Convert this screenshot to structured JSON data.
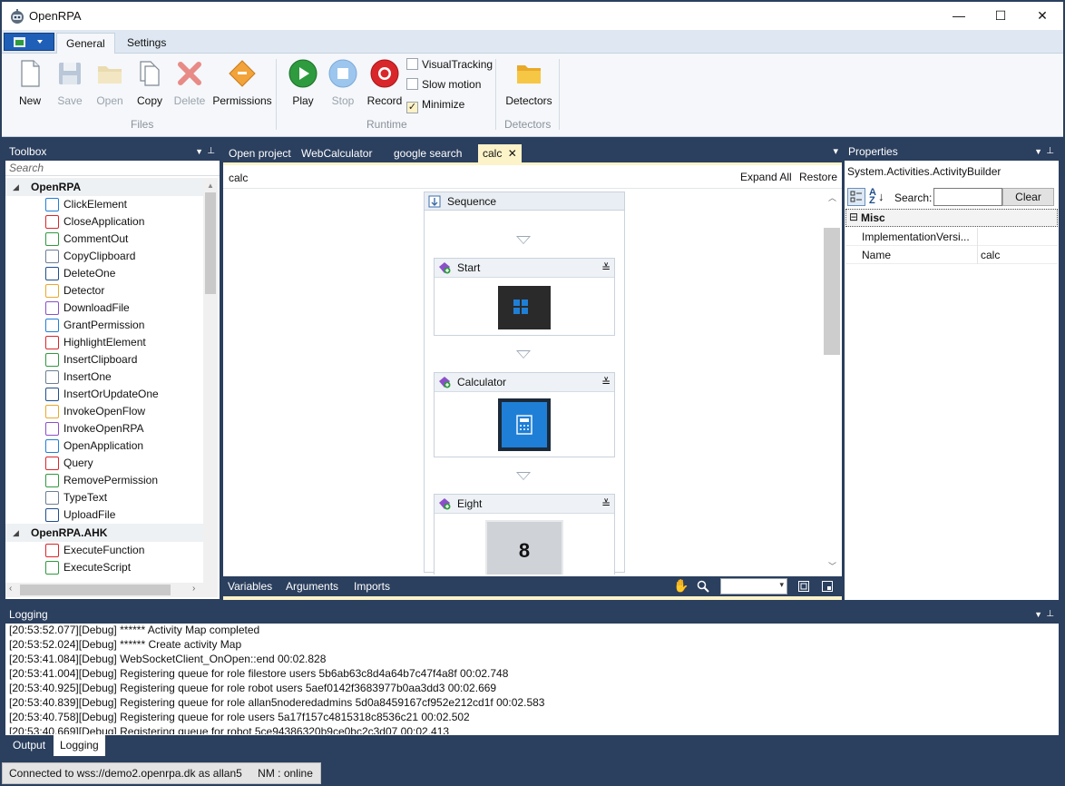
{
  "window": {
    "title": "OpenRPA",
    "controls": [
      "—",
      "☐",
      "✕"
    ]
  },
  "ribbon": {
    "tabs": [
      {
        "label": "General",
        "active": true
      },
      {
        "label": "Settings",
        "active": false
      }
    ],
    "files": {
      "group_label": "Files",
      "buttons": [
        {
          "label": "New",
          "enabled": true
        },
        {
          "label": "Save",
          "enabled": false
        },
        {
          "label": "Open",
          "enabled": false
        },
        {
          "label": "Copy",
          "enabled": true
        },
        {
          "label": "Delete",
          "enabled": false
        },
        {
          "label": "Permissions",
          "enabled": true
        }
      ]
    },
    "runtime": {
      "group_label": "Runtime",
      "buttons": [
        {
          "label": "Play",
          "enabled": true
        },
        {
          "label": "Stop",
          "enabled": false
        },
        {
          "label": "Record",
          "enabled": true
        }
      ],
      "options": [
        {
          "label": "VisualTracking",
          "checked": false
        },
        {
          "label": "Slow motion",
          "checked": false
        },
        {
          "label": "Minimize",
          "checked": true
        }
      ]
    },
    "detectors": {
      "group_label": "Detectors",
      "button_label": "Detectors"
    }
  },
  "toolbox": {
    "title": "Toolbox",
    "search_placeholder": "Search",
    "groups": [
      {
        "name": "OpenRPA",
        "items": [
          "ClickElement",
          "CloseApplication",
          "CommentOut",
          "CopyClipboard",
          "DeleteOne",
          "Detector",
          "DownloadFile",
          "GrantPermission",
          "HighlightElement",
          "InsertClipboard",
          "InsertOne",
          "InsertOrUpdateOne",
          "InvokeOpenFlow",
          "InvokeOpenRPA",
          "OpenApplication",
          "Query",
          "RemovePermission",
          "TypeText",
          "UploadFile"
        ]
      },
      {
        "name": "OpenRPA.AHK",
        "items": [
          "ExecuteFunction",
          "ExecuteScript"
        ]
      }
    ]
  },
  "designer": {
    "tabs": [
      {
        "label": "Open project",
        "active": false
      },
      {
        "label": "WebCalculator",
        "active": false
      },
      {
        "label": "google search",
        "active": false
      },
      {
        "label": "calc",
        "active": true,
        "closable": true
      }
    ],
    "breadcrumb": "calc",
    "expand_all": "Expand All",
    "restore": "Restore",
    "sequence_label": "Sequence",
    "activities": [
      {
        "label": "Start"
      },
      {
        "label": "Calculator"
      },
      {
        "label": "Eight",
        "preview_text": "8"
      }
    ],
    "footer_tabs": [
      "Variables",
      "Arguments",
      "Imports"
    ]
  },
  "properties": {
    "title": "Properties",
    "object_type": "System.Activities.ActivityBuilder",
    "search_label": "Search:",
    "search_value": "",
    "clear_label": "Clear",
    "category": "Misc",
    "rows": [
      {
        "name": "ImplementationVersi...",
        "value": ""
      },
      {
        "name": "Name",
        "value": "calc"
      }
    ]
  },
  "logging": {
    "title": "Logging",
    "lines": [
      "[20:53:52.077][Debug] ****** Activity Map completed",
      "[20:53:52.024][Debug] ****** Create activity Map",
      "[20:53:41.084][Debug] WebSocketClient_OnOpen::end 00:02.828",
      "[20:53:41.004][Debug] Registering queue for role filestore users 5b6ab63c8d4a64b7c47f4a8f 00:02.748",
      "[20:53:40.925][Debug] Registering queue for role robot users 5aef0142f3683977b0aa3dd3 00:02.669",
      "[20:53:40.839][Debug] Registering queue for role allan5noderedadmins 5d0a8459167cf952e212cd1f 00:02.583",
      "[20:53:40.758][Debug] Registering queue for role users 5a17f157c4815318c8536c21 00:02.502",
      "[20:53:40.669][Debug] Registering queue for robot 5ce94386320b9ce0bc2c3d07 00:02.413"
    ],
    "bottom_tabs": [
      {
        "label": "Output",
        "active": false
      },
      {
        "label": "Logging",
        "active": true
      }
    ]
  },
  "status": {
    "text": "Connected to wss://demo2.openrpa.dk as allan5",
    "nm": "NM : online"
  }
}
